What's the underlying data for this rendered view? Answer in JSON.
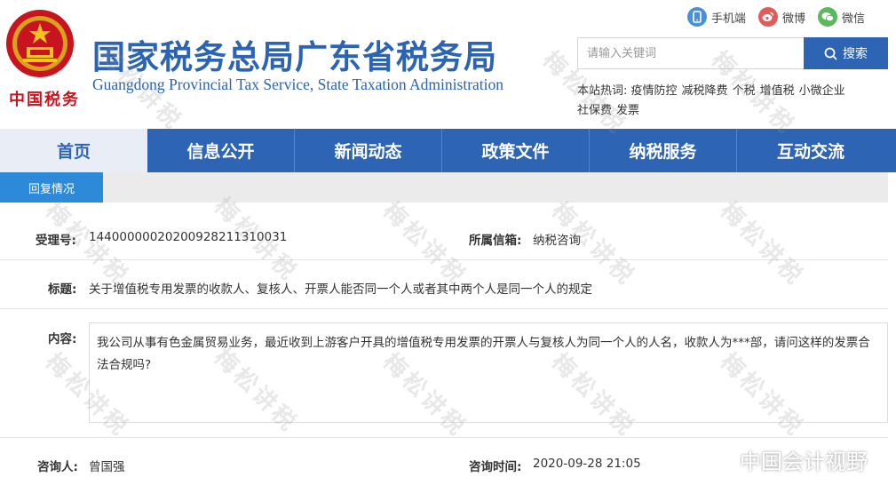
{
  "header": {
    "emblem_text": "中国税务",
    "title": "国家税务总局广东省税务局",
    "subtitle": "Guangdong Provincial Tax Service, State Taxation Administration",
    "top_links": [
      {
        "label": "手机端",
        "icon": "mobile-icon",
        "color": "#4a90d9"
      },
      {
        "label": "微博",
        "icon": "weibo-icon",
        "color": "#e25a5a"
      },
      {
        "label": "微信",
        "icon": "wechat-icon",
        "color": "#5cb85c"
      }
    ],
    "search": {
      "placeholder": "请输入关键词",
      "button": "搜索"
    },
    "hot": {
      "label": "本站热词:",
      "keywords": [
        "疫情防控",
        "减税降费",
        "个税",
        "增值税",
        "小微企业",
        "社保费",
        "发票"
      ]
    }
  },
  "nav": {
    "items": [
      "首页",
      "信息公开",
      "新闻动态",
      "政策文件",
      "纳税服务",
      "互动交流"
    ]
  },
  "subtab": {
    "label": "回复情况"
  },
  "record": {
    "id_label": "受理号:",
    "id_value": "14400000020200928211310031",
    "box_label": "所属信箱:",
    "box_value": "纳税咨询",
    "title_label": "标题:",
    "title_value": "关于增值税专用发票的收款人、复核人、开票人能否同一个人或者其中两个人是同一个人的规定",
    "content_label": "内容:",
    "content_value": "我公司从事有色金属贸易业务，最近收到上游客户开具的增值税专用发票的开票人与复核人为同一个人的人名，收款人为***部，请问这样的发票合法合规吗?",
    "asker_label": "咨询人:",
    "asker_value": "曾国强",
    "time_label": "咨询时间:",
    "time_value": "2020-09-28 21:05"
  },
  "watermark": {
    "text": "梅松讲税"
  },
  "badge": {
    "text": "中国会计视野",
    "icon": "weibo-icon"
  },
  "colors": {
    "brand_blue": "#2d64b4",
    "tab_blue": "#2d8ad8",
    "emblem_red": "#c8141e"
  }
}
